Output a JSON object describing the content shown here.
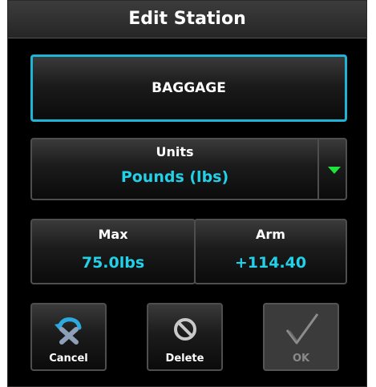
{
  "dialog": {
    "title": "Edit Station"
  },
  "station": {
    "name": "BAGGAGE"
  },
  "units": {
    "label": "Units",
    "value": "Pounds (lbs)"
  },
  "fields": {
    "max_label": "Max",
    "max_value": "75.0lbs",
    "arm_label": "Arm",
    "arm_value": "+114.40"
  },
  "actions": {
    "cancel_label": "Cancel",
    "delete_label": "Delete",
    "ok_label": "OK",
    "ok_enabled": false
  },
  "colors": {
    "accent_cyan": "#22d0e8",
    "selection_border": "#1fb3d6",
    "dropdown_arrow": "#1ee33a"
  },
  "icons": {
    "cancel": "cancel-x-undo-icon",
    "delete": "prohibit-icon",
    "ok": "checkmark-icon",
    "dropdown": "triangle-down-icon"
  }
}
